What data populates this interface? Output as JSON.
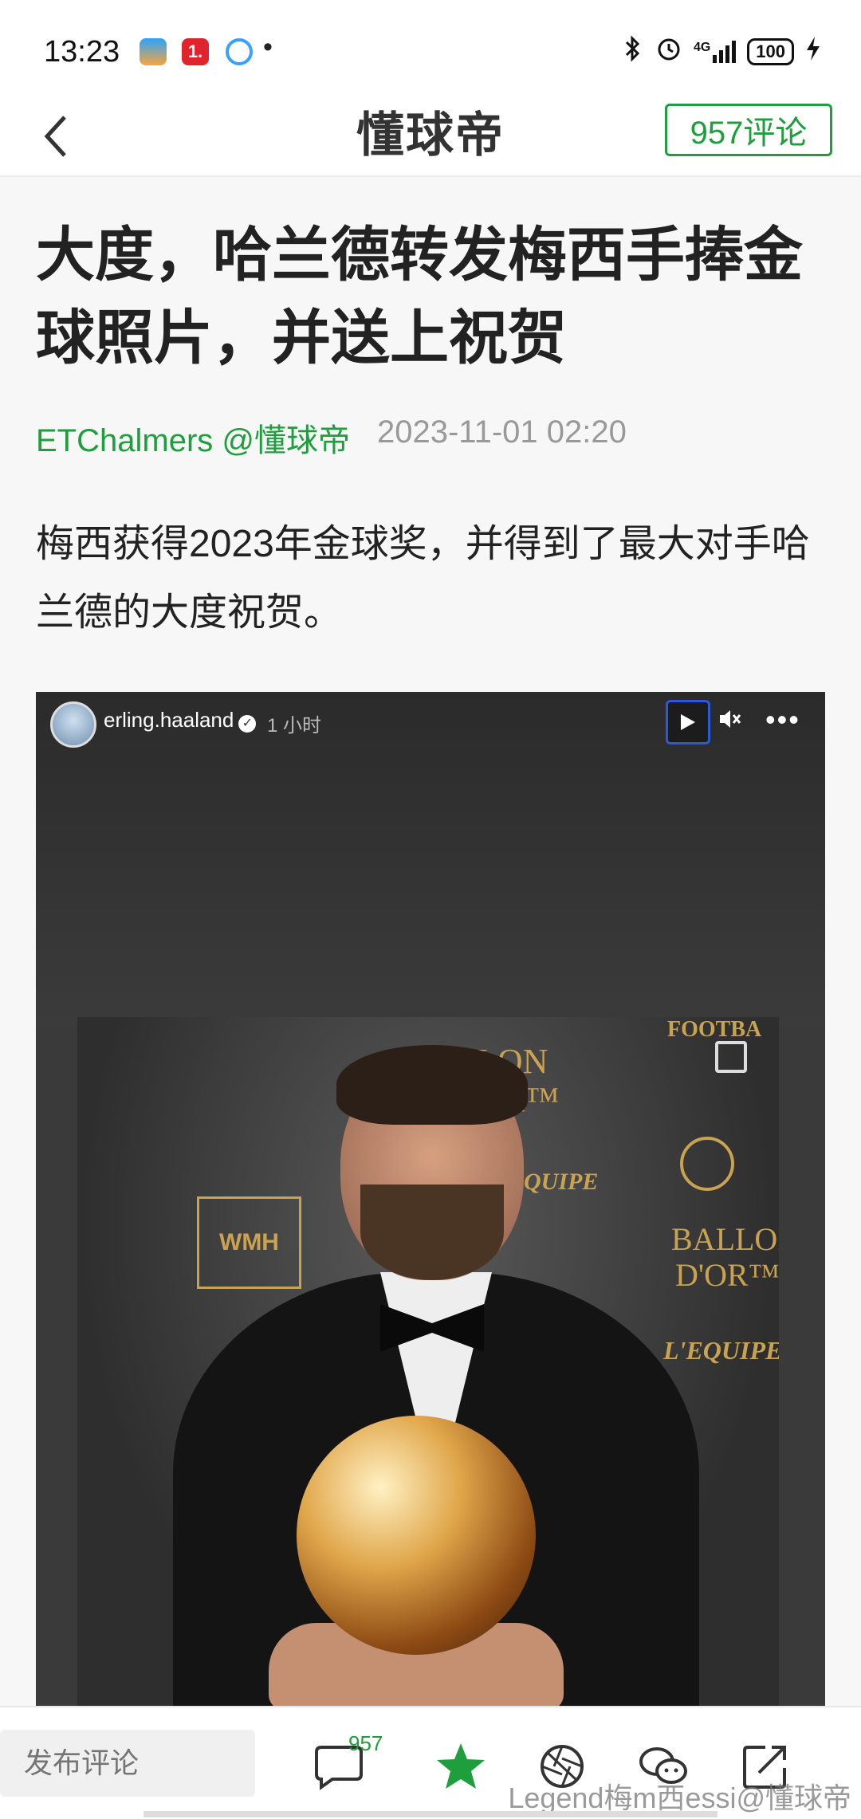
{
  "status_bar": {
    "time": "13:23",
    "app_icon_label": "1.",
    "dot": "•",
    "signal_label": "4G",
    "battery": "100"
  },
  "nav": {
    "title": "懂球帝",
    "comment_button": "957评论"
  },
  "article": {
    "title": "大度，哈兰德转发梅西手捧金球照片，并送上祝贺",
    "author": "ETChalmers @懂球帝",
    "date": "2023-11-01 02:20",
    "body": "梅西获得2023年金球奖，并得到了最大对手哈兰德的大度祝贺。"
  },
  "media": {
    "username": "erling.haaland",
    "verified_mark": "✓",
    "time": "1 小时",
    "photo_texts": {
      "football": "FOOTBA",
      "ballon_top": "LON",
      "dor_top": "OR™",
      "wmh": "WMH",
      "equipe_top": "QUIPE",
      "ballon_side": "BALLOI",
      "dor_side": "D'OR™",
      "equipe_bottom": "L'EQUIPE"
    }
  },
  "bottom_bar": {
    "comment_placeholder": "发布评论",
    "comment_badge": "957",
    "watermark": "Legend梅m西essi@懂球帝"
  },
  "colors": {
    "accent_green": "#1e9e3c",
    "media_bg": "#3a3a3a",
    "gold": "#c9a252"
  }
}
